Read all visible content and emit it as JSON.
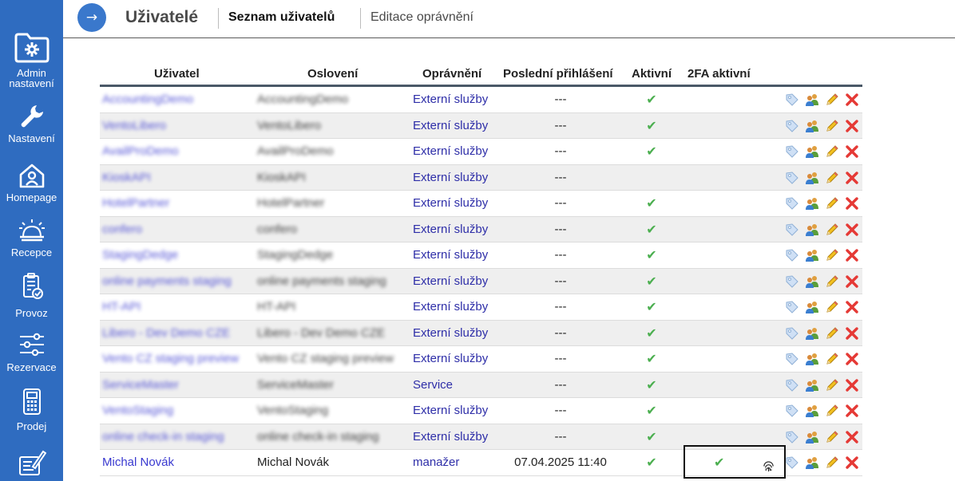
{
  "sidebar": {
    "items": [
      {
        "label": "Admin nastavení",
        "icon": "folder-gear-icon"
      },
      {
        "label": "Nastavení",
        "icon": "wrench-icon"
      },
      {
        "label": "Homepage",
        "icon": "home-user-icon"
      },
      {
        "label": "Recepce",
        "icon": "reception-bell-icon"
      },
      {
        "label": "Provoz",
        "icon": "clipboard-check-icon"
      },
      {
        "label": "Rezervace",
        "icon": "sliders-icon"
      },
      {
        "label": "Prodej",
        "icon": "calculator-icon"
      },
      {
        "label": "",
        "icon": "edit-document-icon"
      }
    ]
  },
  "header": {
    "back_icon": "→",
    "title": "Uživatelé",
    "tabs": [
      {
        "label": "Seznam uživatelů",
        "active": true
      },
      {
        "label": "Editace oprávnění",
        "active": false
      }
    ]
  },
  "table": {
    "columns": [
      "Uživatel",
      "Oslovení",
      "Oprávnění",
      "Poslední přihlášení",
      "Aktivní",
      "2FA aktivní"
    ],
    "check_glyph": "✔",
    "fingerprint_icon": "fingerprint-icon",
    "row_action_icons": [
      "tag-icon",
      "users-icon",
      "pencil-icon",
      "delete-x-icon"
    ],
    "colors": {
      "accent": "#2f6cc0",
      "link": "#3a3ad0",
      "check": "#4caf50",
      "delete": "#e53935"
    },
    "rows": [
      {
        "user": "AccountingDemo",
        "salutation": "AccountingDemo",
        "permission": "Externí služby",
        "last_login": "---",
        "active": true,
        "twofa": false,
        "blurred": true
      },
      {
        "user": "VentoLibero",
        "salutation": "VentoLibero",
        "permission": "Externí služby",
        "last_login": "---",
        "active": true,
        "twofa": false,
        "blurred": true
      },
      {
        "user": "AvailProDemo",
        "salutation": "AvailProDemo",
        "permission": "Externí služby",
        "last_login": "---",
        "active": true,
        "twofa": false,
        "blurred": true
      },
      {
        "user": "KioskAPI",
        "salutation": "KioskAPI",
        "permission": "Externí služby",
        "last_login": "---",
        "active": false,
        "twofa": false,
        "blurred": true
      },
      {
        "user": "HotelPartner",
        "salutation": "HotelPartner",
        "permission": "Externí služby",
        "last_login": "---",
        "active": true,
        "twofa": false,
        "blurred": true
      },
      {
        "user": "confero",
        "salutation": "confero",
        "permission": "Externí služby",
        "last_login": "---",
        "active": true,
        "twofa": false,
        "blurred": true
      },
      {
        "user": "StagingDedge",
        "salutation": "StagingDedge",
        "permission": "Externí služby",
        "last_login": "---",
        "active": true,
        "twofa": false,
        "blurred": true
      },
      {
        "user": "online payments staging",
        "salutation": "online payments staging",
        "permission": "Externí služby",
        "last_login": "---",
        "active": true,
        "twofa": false,
        "blurred": true
      },
      {
        "user": "HT-API",
        "salutation": "HT-API",
        "permission": "Externí služby",
        "last_login": "---",
        "active": true,
        "twofa": false,
        "blurred": true
      },
      {
        "user": "Libero - Dev Demo CZE",
        "salutation": "Libero - Dev Demo CZE",
        "permission": "Externí služby",
        "last_login": "---",
        "active": true,
        "twofa": false,
        "blurred": true
      },
      {
        "user": "Vento CZ staging preview",
        "salutation": "Vento CZ staging preview",
        "permission": "Externí služby",
        "last_login": "---",
        "active": true,
        "twofa": false,
        "blurred": true
      },
      {
        "user": "ServiceMaster",
        "salutation": "ServiceMaster",
        "permission": "Service",
        "last_login": "---",
        "active": true,
        "twofa": false,
        "blurred": true
      },
      {
        "user": "VentoStaging",
        "salutation": "VentoStaging",
        "permission": "Externí služby",
        "last_login": "---",
        "active": true,
        "twofa": false,
        "blurred": true
      },
      {
        "user": "online check-in staging",
        "salutation": "online check-in staging",
        "permission": "Externí služby",
        "last_login": "---",
        "active": true,
        "twofa": false,
        "blurred": true
      },
      {
        "user": "Michal Novák",
        "salutation": "Michal Novák",
        "permission": "manažer",
        "last_login": "07.04.2025 11:40",
        "active": true,
        "twofa": true,
        "blurred": false
      }
    ]
  }
}
